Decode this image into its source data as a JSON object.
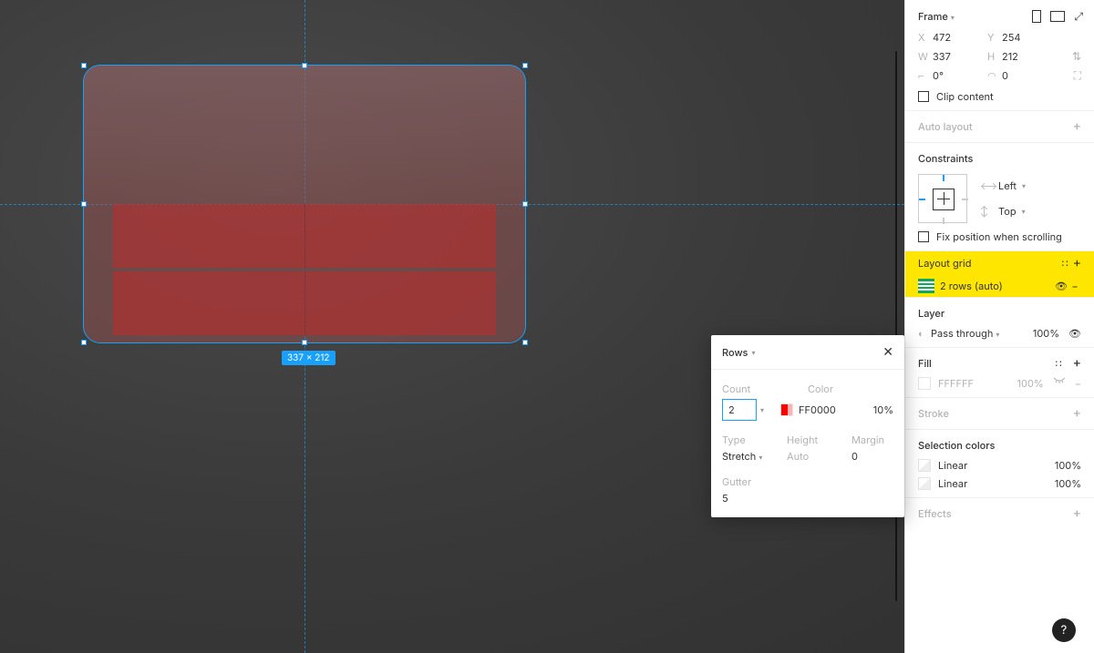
{
  "canvas": {
    "size_badge": "337 × 212"
  },
  "popover": {
    "title": "Rows",
    "count_label": "Count",
    "color_label": "Color",
    "count": "2",
    "hex": "FF0000",
    "opacity": "10%",
    "type_label": "Type",
    "height_label": "Height",
    "margin_label": "Margin",
    "type_value": "Stretch",
    "height_value": "Auto",
    "margin_value": "0",
    "gutter_label": "Gutter",
    "gutter_value": "5"
  },
  "inspector": {
    "frame": {
      "title": "Frame",
      "x_label": "X",
      "x": "472",
      "y_label": "Y",
      "y": "254",
      "w_label": "W",
      "w": "337",
      "h_label": "H",
      "h": "212",
      "rot": "0°",
      "radius": "0",
      "clip": "Clip content"
    },
    "auto_layout": "Auto layout",
    "constraints": {
      "title": "Constraints",
      "h": "Left",
      "v": "Top",
      "fix": "Fix position when scrolling"
    },
    "layout_grid": {
      "title": "Layout grid",
      "row_label": "2 rows (auto)"
    },
    "layer": {
      "title": "Layer",
      "blend": "Pass through",
      "opacity": "100%"
    },
    "fill": {
      "title": "Fill",
      "hex": "FFFFFF",
      "opacity": "100%"
    },
    "stroke": "Stroke",
    "selection_colors": {
      "title": "Selection colors",
      "item": "Linear",
      "opacity": "100%"
    },
    "effects": "Effects"
  },
  "fab": "?"
}
